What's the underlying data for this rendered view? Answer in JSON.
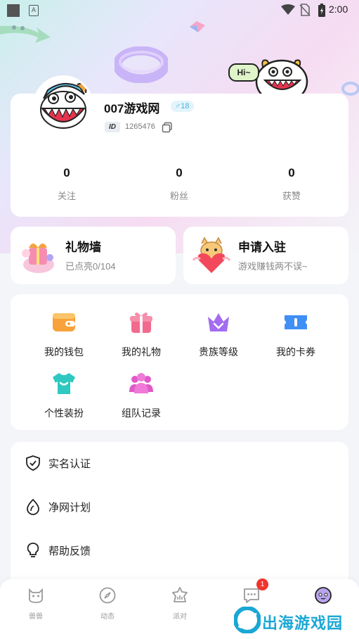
{
  "status_bar": {
    "time": "2:00",
    "a_indicator": "A"
  },
  "mascot": {
    "speech": "Hi~"
  },
  "profile": {
    "username": "007游戏网",
    "level": "♂18",
    "id_tag": "ID",
    "id_value": "1265476",
    "stats": [
      {
        "value": "0",
        "label": "关注"
      },
      {
        "value": "0",
        "label": "粉丝"
      },
      {
        "value": "0",
        "label": "获赞"
      }
    ]
  },
  "features": {
    "gift_wall": {
      "title": "礼物墙",
      "subtitle": "已点亮0/104"
    },
    "apply": {
      "title": "申请入驻",
      "subtitle": "游戏赚钱两不误~"
    }
  },
  "grid": [
    {
      "label": "我的钱包",
      "icon": "wallet-icon"
    },
    {
      "label": "我的礼物",
      "icon": "gift-icon"
    },
    {
      "label": "贵族等级",
      "icon": "crown-icon"
    },
    {
      "label": "我的卡券",
      "icon": "ticket-icon"
    },
    {
      "label": "个性装扮",
      "icon": "tshirt-icon"
    },
    {
      "label": "组队记录",
      "icon": "team-icon"
    }
  ],
  "list": [
    {
      "label": "实名认证",
      "icon": "shield-check-icon"
    },
    {
      "label": "净网计划",
      "icon": "leaf-icon"
    },
    {
      "label": "帮助反馈",
      "icon": "lightbulb-icon"
    }
  ],
  "nav": [
    {
      "label": "兽兽",
      "icon": "beast-icon"
    },
    {
      "label": "动态",
      "icon": "compass-icon"
    },
    {
      "label": "派对",
      "icon": "party-icon"
    },
    {
      "label": "",
      "icon": "message-icon",
      "badge": "1"
    },
    {
      "label": "",
      "icon": "profile-face-icon"
    }
  ],
  "watermark": {
    "text": "出海游戏园"
  },
  "colors": {
    "wallet": "#f7a23b",
    "gift": "#f26a8d",
    "crown": "#a46cf0",
    "ticket": "#3f8ff5",
    "tshirt": "#2ec8c1",
    "team": "#e05ac7",
    "badge": "#f0342e",
    "level_text": "#4bb3e0"
  }
}
